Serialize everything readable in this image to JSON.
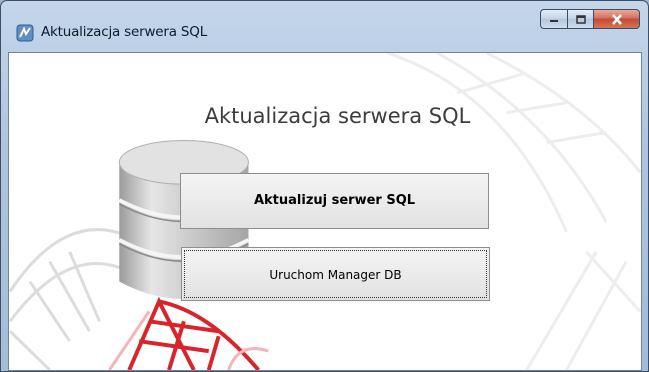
{
  "window": {
    "title": "Aktualizacja serwera SQL",
    "icon": "app-icon",
    "controls": [
      "minimize-icon",
      "maximize-icon",
      "close-icon"
    ]
  },
  "main": {
    "heading": "Aktualizacja serwera SQL",
    "primary_button": "Aktualizuj serwer SQL",
    "secondary_button": "Uruchom Manager DB"
  },
  "colors": {
    "accent_red": "#d9242b",
    "database_grey": "#c8c8c8",
    "close_button": "#c44b2f"
  }
}
